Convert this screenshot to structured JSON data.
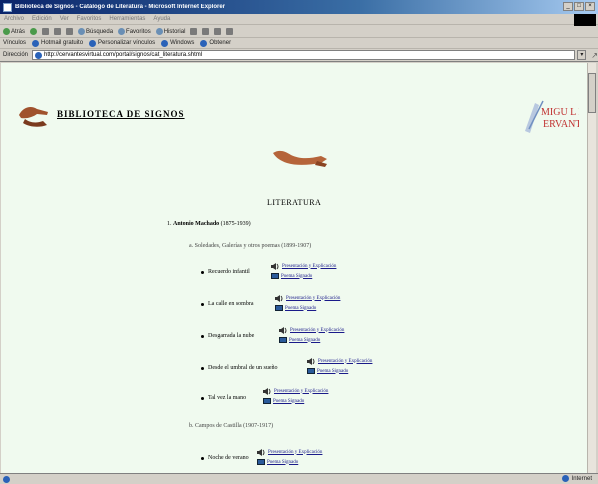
{
  "window": {
    "title": "Biblioteca de Signos - Catálogo de Literatura - Microsoft Internet Explorer"
  },
  "menu": [
    "Archivo",
    "Edición",
    "Ver",
    "Favoritos",
    "Herramientas",
    "Ayuda"
  ],
  "toolbar": {
    "back": "Atrás",
    "search": "Búsqueda",
    "favorites": "Favoritos",
    "history": "Historial"
  },
  "links": [
    "Vínculos",
    "Hotmail gratuito",
    "Personalizar vínculos",
    "Windows",
    "Obtener"
  ],
  "address": {
    "label": "Dirección",
    "url": "http://cervantesvirtual.com/portal/signos/cat_literatura.shtml"
  },
  "status": {
    "zone": "Internet"
  },
  "page": {
    "site_title": "BIBLIOTECA DE SIGNOS",
    "cervantes_logo": "MIGUEL DE CERVANTES",
    "heading": "LITERATURA",
    "author": {
      "number": "1.",
      "name": "Antonio Machado",
      "years": "(1875-1939)"
    },
    "collections": [
      {
        "label": "a. Soledades, Galerías y otros poemas (1899-1907)",
        "poems": [
          {
            "title": "Recuerdo infantil",
            "link1": "Presentación y Explicación",
            "link2": "Poema Signado"
          },
          {
            "title": "La calle en sombra",
            "link1": "Presentación y Explicación",
            "link2": "Poema Signado"
          },
          {
            "title": "Desgarrada la nube",
            "link1": "Presentación y Explicación",
            "link2": "Poema Signado"
          },
          {
            "title": "Desde el umbral de un sueño",
            "link1": "Presentación y Explicación",
            "link2": "Poema Signado"
          },
          {
            "title": "Tal vez la mano",
            "link1": "Presentación y Explicación",
            "link2": "Poema Signado"
          }
        ]
      },
      {
        "label": "b. Campos de Castilla (1907-1917)",
        "poems": [
          {
            "title": "Noche de verano",
            "link1": "Presentación y Explicación",
            "link2": "Poema Signado"
          }
        ]
      }
    ]
  }
}
